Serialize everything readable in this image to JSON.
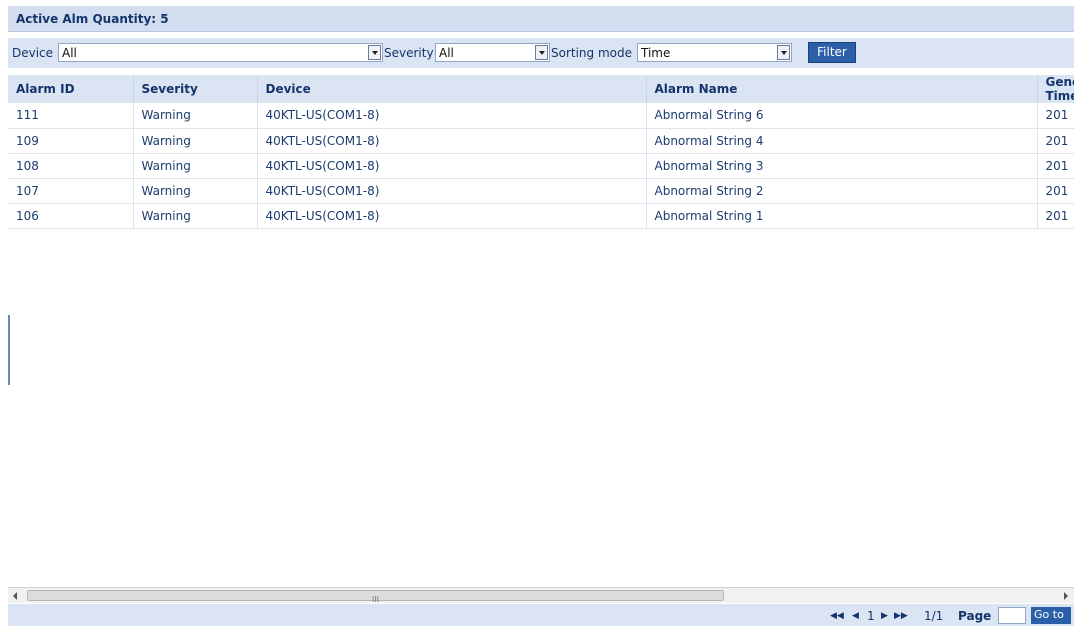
{
  "header": {
    "title": "Active Alm Quantity: 5"
  },
  "filters": {
    "device_label": "Device",
    "device_value": "All",
    "severity_label": "Severity",
    "severity_value": "All",
    "sorting_label": "Sorting mode",
    "sorting_value": "Time",
    "filter_button": "Filter"
  },
  "table": {
    "columns": [
      "Alarm ID",
      "Severity",
      "Device",
      "Alarm Name",
      "Generation Time"
    ],
    "rows": [
      [
        "111",
        "Warning",
        "40KTL-US(COM1-8)",
        "Abnormal String 6",
        "201"
      ],
      [
        "109",
        "Warning",
        "40KTL-US(COM1-8)",
        "Abnormal String 4",
        "201"
      ],
      [
        "108",
        "Warning",
        "40KTL-US(COM1-8)",
        "Abnormal String 3",
        "201"
      ],
      [
        "107",
        "Warning",
        "40KTL-US(COM1-8)",
        "Abnormal String 2",
        "201"
      ],
      [
        "106",
        "Warning",
        "40KTL-US(COM1-8)",
        "Abnormal String 1",
        "201"
      ]
    ]
  },
  "scrollbar": {
    "grip": "III"
  },
  "pager": {
    "first": "◀◀",
    "prev": "◀",
    "current_page": "1",
    "next": "▶",
    "last": "▶▶",
    "page_count": "1/1",
    "page_label": "Page",
    "page_input_value": "",
    "goto_button": "Go to"
  },
  "colors": {
    "header_bg": "#d2ddf0",
    "toolbar_bg": "#dbe4f3",
    "button_bg": "#2b5fa8",
    "text": "#14356b"
  }
}
